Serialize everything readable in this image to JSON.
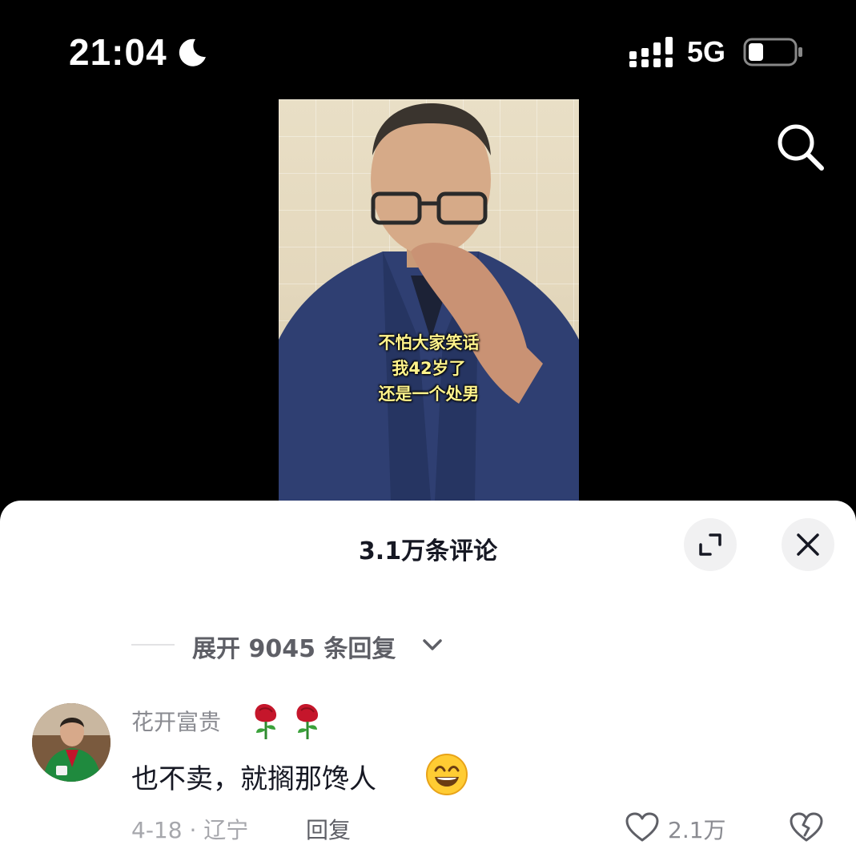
{
  "status_bar": {
    "time": "21:04",
    "network": "5G",
    "icons": [
      "moon-icon",
      "cellular-signal-icon",
      "battery-icon"
    ]
  },
  "video": {
    "subtitle_lines": [
      "不怕大家笑话",
      "我42岁了",
      "还是一个处男"
    ]
  },
  "comments_sheet": {
    "title": "3.1万条评论",
    "expand_replies": "展开 9045 条回复",
    "comment": {
      "username": "花开富贵",
      "username_emojis": "🌹🌹",
      "text": "也不卖，就搁那馋人",
      "date_location": "4-18 · 辽宁",
      "reply_label": "回复",
      "like_count": "2.1万"
    }
  },
  "colors": {
    "primary_text": "#161823",
    "secondary_text": "#8a8b91",
    "subtitle": "#fff38c"
  }
}
